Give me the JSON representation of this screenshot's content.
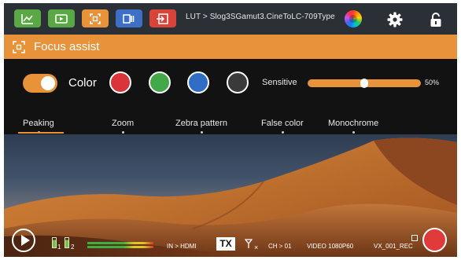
{
  "topbar": {
    "buttons": [
      {
        "name": "waveform-icon",
        "color": "#5aa843"
      },
      {
        "name": "video-icon",
        "color": "#5aa843"
      },
      {
        "name": "focus-icon",
        "color": "#e8923a"
      },
      {
        "name": "false-color-icon",
        "color": "#3d6fc4"
      },
      {
        "name": "input-icon",
        "color": "#d9443a"
      }
    ],
    "lut_text": "LUT > Slog3SGamut3.CineToLC-709Type",
    "color_wheel": "color-wheel-icon",
    "settings": "gear-icon",
    "lock": "lock-icon"
  },
  "focus_assist": {
    "title": "Focus assist",
    "icon": "focus-icon"
  },
  "controls": {
    "toggle_on": true,
    "color_label": "Color",
    "swatches": [
      {
        "name": "red",
        "hex": "#d8343a"
      },
      {
        "name": "green",
        "hex": "#43a84a"
      },
      {
        "name": "blue",
        "hex": "#2f6ec4"
      },
      {
        "name": "gray",
        "hex": "#3a3a3a"
      }
    ],
    "sensitive_label": "Sensitive",
    "sensitive_value": "50%",
    "sensitive_fraction": 0.5
  },
  "tabs": [
    {
      "label": "Peaking",
      "active": true
    },
    {
      "label": "Zoom",
      "active": false
    },
    {
      "label": "Zebra pattern",
      "active": false
    },
    {
      "label": "False color",
      "active": false
    },
    {
      "label": "Monochrome",
      "active": false
    }
  ],
  "status": {
    "battery_1": "1",
    "battery_2": "2",
    "input": "IN > HDMI",
    "tx": "TX",
    "signal_mark": "×",
    "channel": "CH > 01",
    "video": "VIDEO 1080P60",
    "rec_name": "VX_001_REC"
  }
}
